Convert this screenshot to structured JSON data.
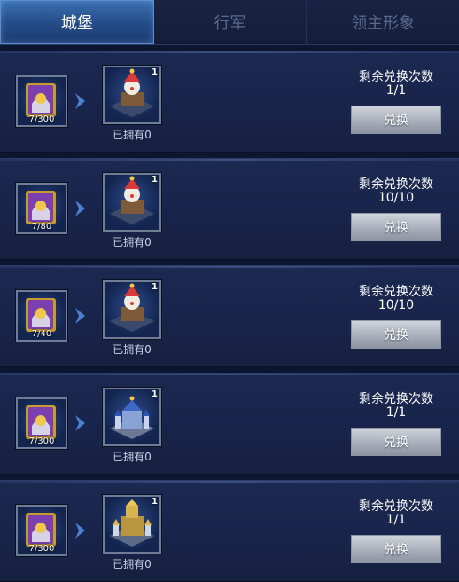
{
  "tabs": [
    {
      "label": "城堡",
      "active": true
    },
    {
      "label": "行军",
      "active": false
    },
    {
      "label": "领主形象",
      "active": false
    }
  ],
  "labels": {
    "remaining_title": "剩余兑换次数",
    "owned_prefix": "已拥有",
    "exchange_button": "兑换"
  },
  "items": [
    {
      "cost": "7/300",
      "building": "jester-castle-icon",
      "quantity": "1",
      "owned": "已拥有0",
      "remaining": "1/1",
      "button": "兑换"
    },
    {
      "cost": "7/80",
      "building": "jester-castle-icon",
      "quantity": "1",
      "owned": "已拥有0",
      "remaining": "10/10",
      "button": "兑换"
    },
    {
      "cost": "7/40",
      "building": "jester-castle-icon",
      "quantity": "1",
      "owned": "已拥有0",
      "remaining": "10/10",
      "button": "兑换"
    },
    {
      "cost": "7/300",
      "building": "blue-palace-castle-icon",
      "quantity": "1",
      "owned": "已拥有0",
      "remaining": "1/1",
      "button": "兑换"
    },
    {
      "cost": "7/300",
      "building": "golden-fortress-castle-icon",
      "quantity": "1",
      "owned": "已拥有0",
      "remaining": "1/1",
      "button": "兑换"
    }
  ],
  "colors": {
    "background": "#0d1630",
    "active_tab": "#2f5d9a",
    "button": "#a9afba"
  }
}
